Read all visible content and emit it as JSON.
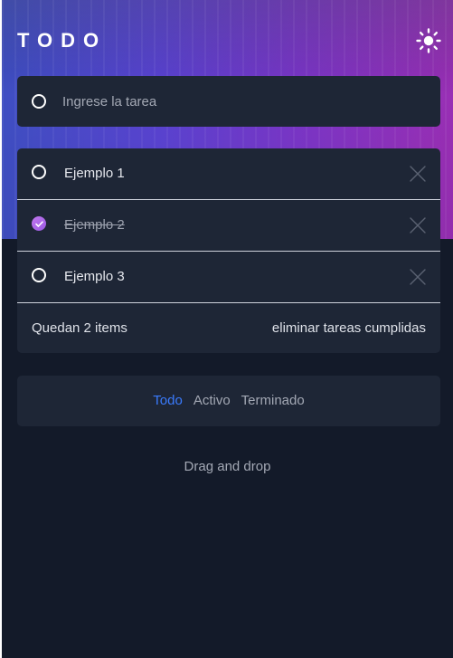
{
  "header": {
    "title": "TODO",
    "theme_icon": "sun-icon"
  },
  "new_task": {
    "placeholder": "Ingrese la tarea",
    "value": ""
  },
  "tasks": [
    {
      "label": "Ejemplo 1",
      "completed": false
    },
    {
      "label": "Ejemplo 2",
      "completed": true
    },
    {
      "label": "Ejemplo 3",
      "completed": false
    }
  ],
  "list_footer": {
    "items_left": "Quedan 2 items",
    "clear_completed": "eliminar tareas cumplidas"
  },
  "filters": {
    "all": "Todo",
    "active": "Activo",
    "completed": "Terminado",
    "selected": "Todo"
  },
  "hint": "Drag and drop",
  "colors": {
    "accent": "#3a7bfd",
    "check_gradient": [
      "#c178ee",
      "#9a59e3"
    ],
    "background": "#131a29",
    "card": "#1e2636"
  }
}
